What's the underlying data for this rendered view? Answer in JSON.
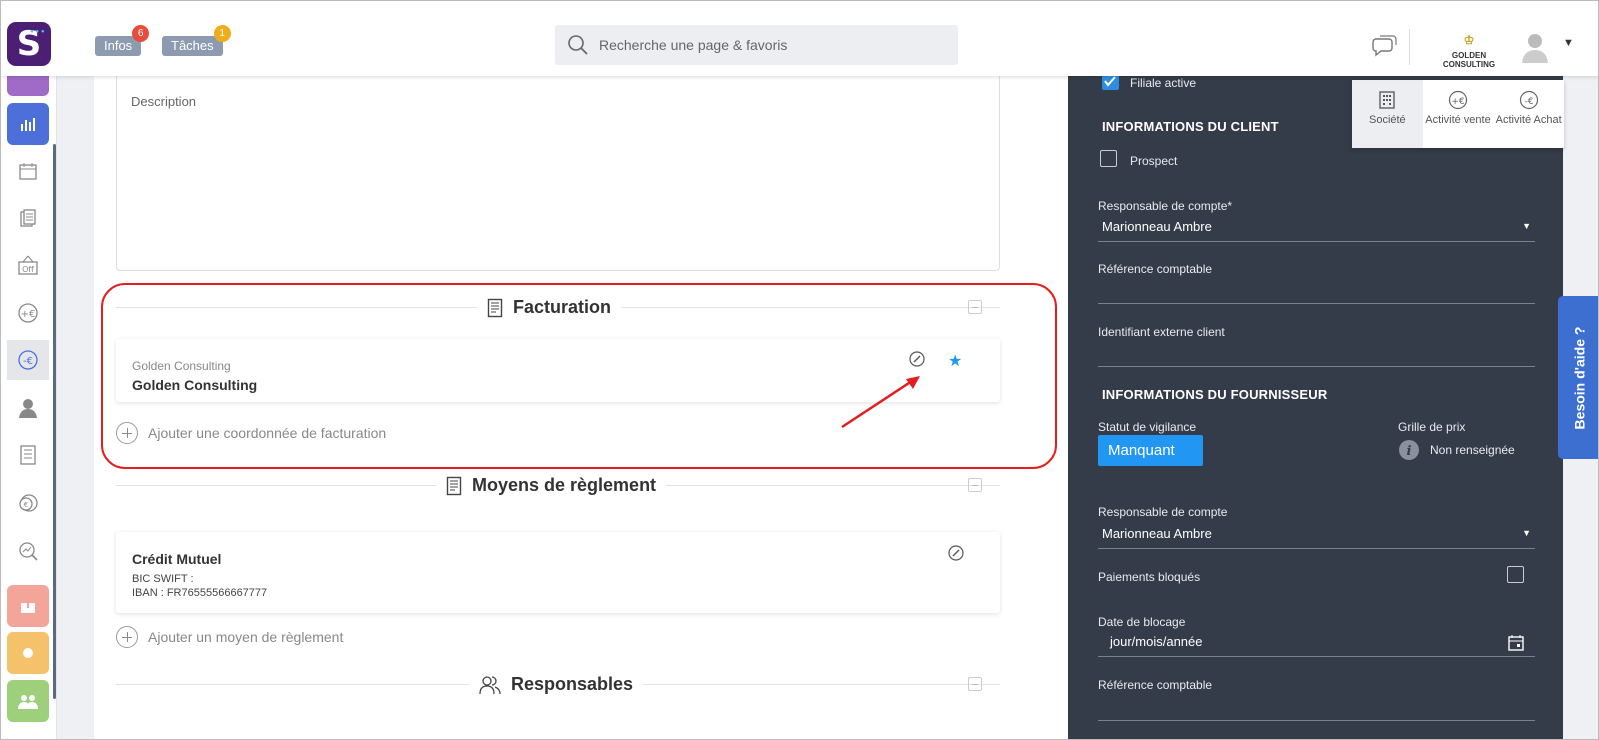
{
  "topbar": {
    "logo_letter": "S",
    "infos_label": "Infos",
    "infos_count": "6",
    "taches_label": "Tâches",
    "taches_count": "1",
    "search_placeholder": "Recherche une page & favoris",
    "company_name": "GOLDEN CONSULTING"
  },
  "main": {
    "description_label": "Description",
    "facturation": {
      "title": "Facturation",
      "card_subtitle": "Golden Consulting",
      "card_title": "Golden Consulting",
      "add_label": "Ajouter une coordonnée de facturation"
    },
    "reglement": {
      "title": "Moyens de règlement",
      "bank": "Crédit Mutuel",
      "bic": "BIC SWIFT :",
      "iban": "IBAN : FR76555566667777",
      "add_label": "Ajouter un moyen de règlement"
    },
    "responsables": {
      "title": "Responsables"
    }
  },
  "panel": {
    "filiale_label": "Filiale active",
    "client_header": "INFORMATIONS DU CLIENT",
    "prospect_label": "Prospect",
    "resp_compte_req_label": "Responsable de compte*",
    "resp_compte_value": "Marionneau Ambre",
    "ref_comptable_label": "Référence comptable",
    "ident_externe_label": "Identifiant externe client",
    "fournisseur_header": "INFORMATIONS DU FOURNISSEUR",
    "statut_label": "Statut de vigilance",
    "statut_value": "Manquant",
    "grille_label": "Grille de prix",
    "grille_value": "Non renseignée",
    "resp_compte2_label": "Responsable de compte",
    "resp_compte2_value": "Marionneau Ambre",
    "paiements_label": "Paiements bloqués",
    "date_blocage_label": "Date de blocage",
    "date_blocage_placeholder": "jour/mois/année",
    "ref_comptable2_label": "Référence comptable"
  },
  "tabs": [
    {
      "label": "Société"
    },
    {
      "label": "Activité vente"
    },
    {
      "label": "Activité Achat"
    }
  ],
  "help": {
    "label": "Besoin d'aide ?"
  },
  "colors": {
    "brand": "#4a1f74",
    "panel_bg": "#343b49",
    "accent_blue": "#2196f3",
    "highlight_red": "#e41e1e",
    "help_bg": "#3d6fd1"
  }
}
